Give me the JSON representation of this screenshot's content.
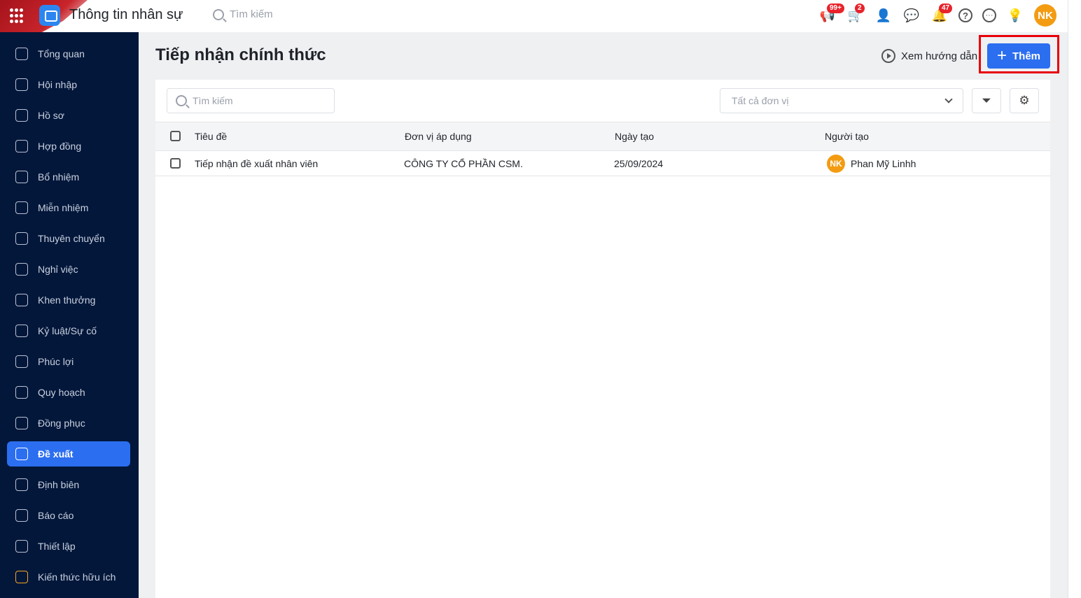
{
  "header": {
    "app_title": "Thông tin nhân sự",
    "search_placeholder": "Tìm kiếm",
    "badges": {
      "announcements": "99+",
      "cart": "2",
      "notifications": "47"
    },
    "avatar": "NK"
  },
  "sidebar": {
    "items": [
      {
        "label": "Tổng quan"
      },
      {
        "label": "Hội nhập"
      },
      {
        "label": "Hồ sơ"
      },
      {
        "label": "Hợp đồng"
      },
      {
        "label": "Bổ nhiệm"
      },
      {
        "label": "Miễn nhiệm"
      },
      {
        "label": "Thuyên chuyển"
      },
      {
        "label": "Nghỉ việc"
      },
      {
        "label": "Khen thưởng"
      },
      {
        "label": "Kỷ luật/Sự cố"
      },
      {
        "label": "Phúc lợi"
      },
      {
        "label": "Quy hoạch"
      },
      {
        "label": "Đồng phục"
      },
      {
        "label": "Đề xuất",
        "active": true
      },
      {
        "label": "Định biên"
      },
      {
        "label": "Báo cáo"
      },
      {
        "label": "Thiết lập"
      },
      {
        "label": "Kiến thức hữu ích"
      }
    ]
  },
  "main": {
    "title": "Tiếp nhận chính thức",
    "guide_label": "Xem hướng dẫn",
    "add_label": "Thêm",
    "search_placeholder": "Tìm kiếm",
    "unit_placeholder": "Tất cả đơn vị",
    "columns": [
      "Tiêu đề",
      "Đơn vị áp dụng",
      "Ngày tạo",
      "Người tạo"
    ],
    "rows": [
      {
        "title": "Tiếp nhận đề xuất nhân viên",
        "unit": "CÔNG TY CỔ PHẦN CSM.",
        "date": "25/09/2024",
        "creator": "Phan Mỹ Linhh",
        "creator_avatar": "NK"
      }
    ]
  },
  "colors": {
    "accent": "#2b6ef0",
    "sidebar": "#03173b",
    "highlight": "#e8000b"
  }
}
